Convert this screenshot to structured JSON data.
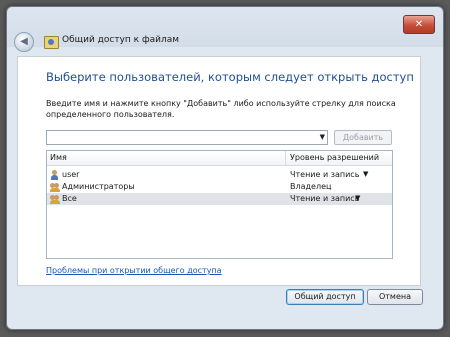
{
  "window": {
    "title": "Общий доступ к файлам",
    "close_glyph": "✕",
    "back_glyph": "◀"
  },
  "heading": "Выберите пользователей, которым следует открыть доступ",
  "instruction": "Введите имя и нажмите кнопку \"Добавить\" либо используйте стрелку для поиска определенного пользователя.",
  "input": {
    "value": "",
    "arrow_glyph": "▼",
    "add_label": "Добавить"
  },
  "list": {
    "headers": {
      "name": "Имя",
      "permission": "Уровень разрешений"
    },
    "rows": [
      {
        "name": "user",
        "permission": "Чтение и запись",
        "icon": "user-icon",
        "has_dropdown": true
      },
      {
        "name": "Администраторы",
        "permission": "Владелец",
        "icon": "group-icon",
        "has_dropdown": false
      },
      {
        "name": "Все",
        "permission": "Чтение и запись",
        "icon": "group-icon",
        "has_dropdown": true
      }
    ],
    "dropdown_glyph": "▼"
  },
  "help_link": "Проблемы при открытии общего доступа",
  "buttons": {
    "share": "Общий доступ",
    "cancel": "Отмена"
  },
  "colors": {
    "heading": "#1f4f93",
    "link": "#1756b8",
    "selected_row": "#dfe3e8"
  }
}
